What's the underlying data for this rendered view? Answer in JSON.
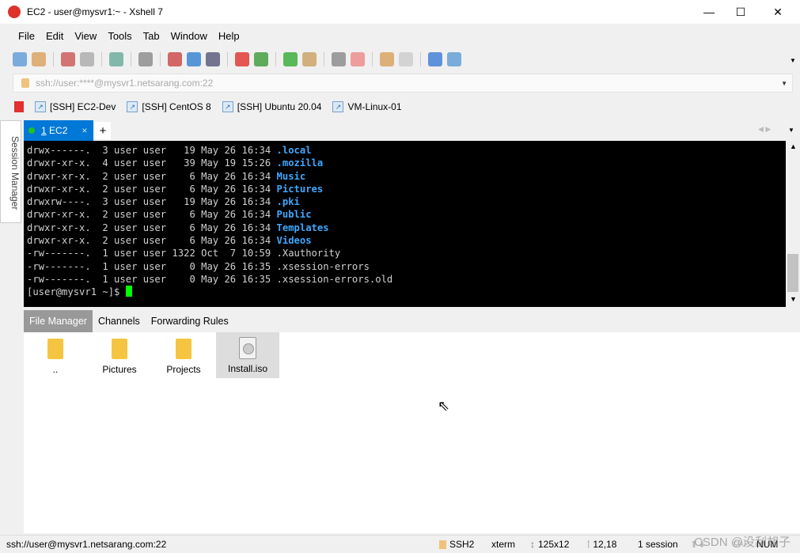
{
  "window": {
    "title": "EC2 - user@mysvr1:~ - Xshell 7",
    "minimize": "—",
    "maximize": "☐",
    "close": "✕"
  },
  "menu": [
    "File",
    "Edit",
    "View",
    "Tools",
    "Tab",
    "Window",
    "Help"
  ],
  "toolbar_icons": [
    "new-session-icon",
    "open-folder-icon",
    "connect-icon",
    "disconnect-icon",
    "properties-icon",
    "find-icon",
    "transfer-icon",
    "globe-icon",
    "font-icon",
    "xshell-icon",
    "xftp-icon",
    "fullscreen-icon",
    "lock-icon",
    "keyboard-icon",
    "highlight-icon",
    "new-folder-icon",
    "layout-icon",
    "help-icon",
    "chat-icon"
  ],
  "address": {
    "value": "ssh://user:****@mysvr1.netsarang.com:22"
  },
  "links": [
    "[SSH] EC2-Dev",
    "[SSH] CentOS 8",
    "[SSH] Ubuntu 20.04",
    "VM-Linux-01"
  ],
  "session_manager": "Session Manager",
  "tabs": [
    {
      "num": "1",
      "label": "EC2",
      "close": "×",
      "status_color": "#22c022"
    }
  ],
  "tab_add": "+",
  "terminal": {
    "lines": [
      {
        "perm": "drwx------.",
        "links": "3",
        "owner": "user",
        "group": "user",
        "size": "19",
        "date": "May 26 16:34",
        "name": ".local",
        "dir": true
      },
      {
        "perm": "drwxr-xr-x.",
        "links": "4",
        "owner": "user",
        "group": "user",
        "size": "39",
        "date": "May 19 15:26",
        "name": ".mozilla",
        "dir": true
      },
      {
        "perm": "drwxr-xr-x.",
        "links": "2",
        "owner": "user",
        "group": "user",
        "size": "6",
        "date": "May 26 16:34",
        "name": "Music",
        "dir": true
      },
      {
        "perm": "drwxr-xr-x.",
        "links": "2",
        "owner": "user",
        "group": "user",
        "size": "6",
        "date": "May 26 16:34",
        "name": "Pictures",
        "dir": true
      },
      {
        "perm": "drwxrw----.",
        "links": "3",
        "owner": "user",
        "group": "user",
        "size": "19",
        "date": "May 26 16:34",
        "name": ".pki",
        "dir": true
      },
      {
        "perm": "drwxr-xr-x.",
        "links": "2",
        "owner": "user",
        "group": "user",
        "size": "6",
        "date": "May 26 16:34",
        "name": "Public",
        "dir": true
      },
      {
        "perm": "drwxr-xr-x.",
        "links": "2",
        "owner": "user",
        "group": "user",
        "size": "6",
        "date": "May 26 16:34",
        "name": "Templates",
        "dir": true
      },
      {
        "perm": "drwxr-xr-x.",
        "links": "2",
        "owner": "user",
        "group": "user",
        "size": "6",
        "date": "May 26 16:34",
        "name": "Videos",
        "dir": true
      },
      {
        "perm": "-rw-------.",
        "links": "1",
        "owner": "user",
        "group": "user",
        "size": "1322",
        "date": "Oct  7 10:59",
        "name": ".Xauthority",
        "dir": false
      },
      {
        "perm": "-rw-------.",
        "links": "1",
        "owner": "user",
        "group": "user",
        "size": "0",
        "date": "May 26 16:35",
        "name": ".xsession-errors",
        "dir": false
      },
      {
        "perm": "-rw-------.",
        "links": "1",
        "owner": "user",
        "group": "user",
        "size": "0",
        "date": "May 26 16:35",
        "name": ".xsession-errors.old",
        "dir": false
      }
    ],
    "prompt": "[user@mysvr1 ~]$ "
  },
  "bottom_tabs": [
    "File Manager",
    "Channels",
    "Forwarding Rules"
  ],
  "files": [
    {
      "name": "..",
      "type": "folder"
    },
    {
      "name": "Pictures",
      "type": "folder"
    },
    {
      "name": "Projects",
      "type": "folder"
    },
    {
      "name": "Install.iso",
      "type": "iso",
      "selected": true
    }
  ],
  "status": {
    "address": "ssh://user@mysvr1.netsarang.com:22",
    "protocol": "SSH2",
    "term": "xterm",
    "size": "125x12",
    "cursor": "12,18",
    "sessions": "1 session",
    "cap": "CAP",
    "num": "NUM"
  },
  "watermark": "CSDN @没刮胡子"
}
